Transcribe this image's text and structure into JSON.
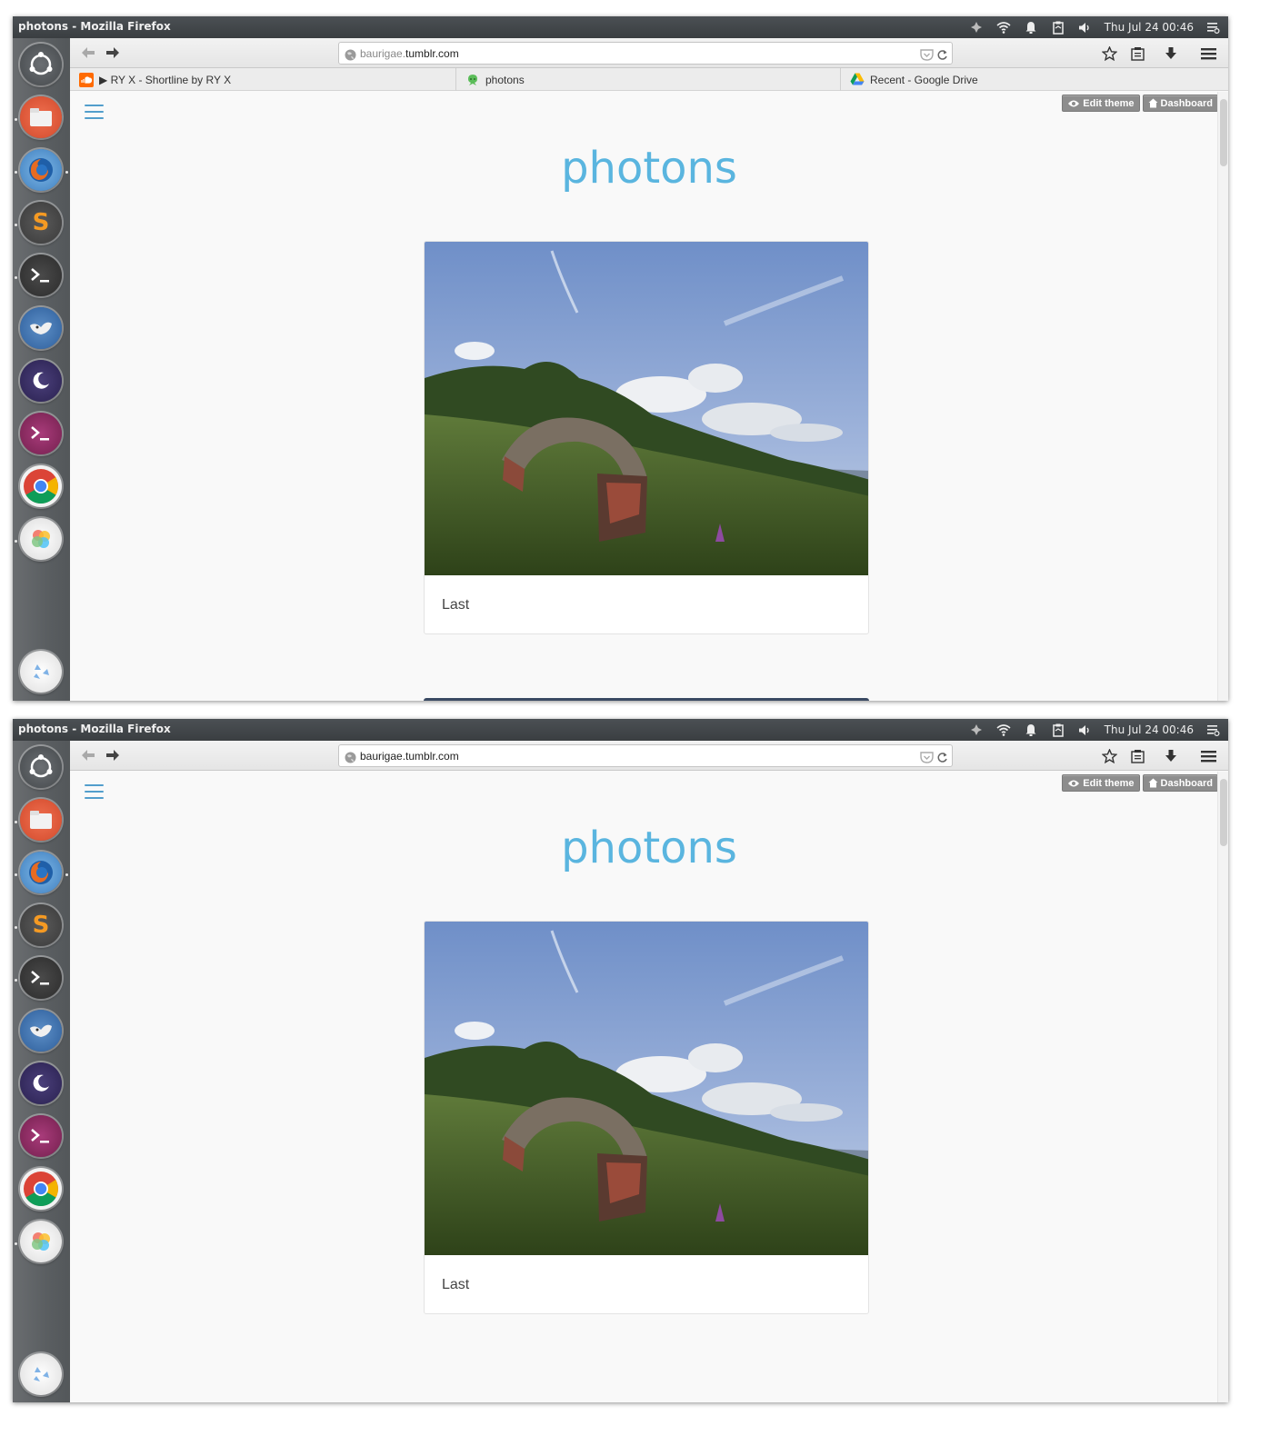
{
  "panel": {
    "window_title": "photons - Mozilla Firefox",
    "clock": "Thu Jul 24  00:46"
  },
  "browser": {
    "url_domain_dim": "baurigae.",
    "url_domain": "tumblr.com",
    "url_full": "baurigae.tumblr.com",
    "tabs": [
      {
        "label": "▶ RY X - Shortline by RY X",
        "icon": "soundcloud-icon"
      },
      {
        "label": "photons",
        "icon": "tumblr-alien-icon"
      },
      {
        "label": "Recent - Google Drive",
        "icon": "google-drive-icon"
      }
    ]
  },
  "page": {
    "edit_theme_label": "Edit theme",
    "dashboard_label": "Dashboard",
    "blog_title": "photons",
    "post_caption": "Last"
  },
  "launcher": {
    "apps": [
      "dash-icon",
      "files-icon",
      "firefox-icon",
      "sublime-text-icon",
      "terminal-icon",
      "gimp-icon",
      "night-theme-icon",
      "ubuntu-terminal-icon",
      "chrome-icon",
      "photos-icon",
      "trash-icon"
    ]
  },
  "colors": {
    "title_blue": "#5ab5df",
    "hamburger_blue": "#529ecc",
    "panel_dark": "#3f4346"
  }
}
